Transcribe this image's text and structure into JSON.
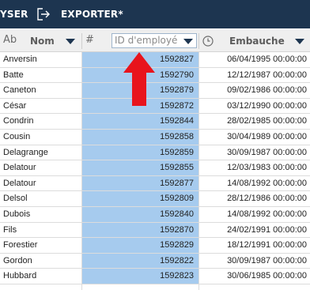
{
  "toolbar": {
    "analyser_label": "YSER",
    "exporter_label": "EXPORTER*",
    "export_icon": "export-icon"
  },
  "columns": {
    "name": {
      "type_glyph": "Ab",
      "label": "Nom"
    },
    "id": {
      "type_glyph": "#",
      "label": "ID d'employé"
    },
    "hire": {
      "type_icon": "clock-icon",
      "label": "Embauche"
    }
  },
  "colors": {
    "toolbar_bg": "#1d3550",
    "selected_column": "#a6cbee",
    "annotation_arrow": "#e8141c"
  },
  "rows": [
    {
      "name": "Anversin",
      "id": "1592827",
      "date": "06/04/1995 00:00:00"
    },
    {
      "name": "Batte",
      "id": "1592790",
      "date": "12/12/1987 00:00:00"
    },
    {
      "name": "Caneton",
      "id": "1592879",
      "date": "09/02/1986 00:00:00"
    },
    {
      "name": "César",
      "id": "1592872",
      "date": "03/12/1990 00:00:00"
    },
    {
      "name": "Condrin",
      "id": "1592844",
      "date": "28/02/1985 00:00:00"
    },
    {
      "name": "Cousin",
      "id": "1592858",
      "date": "30/04/1989 00:00:00"
    },
    {
      "name": "Delagrange",
      "id": "1592859",
      "date": "30/09/1987 00:00:00"
    },
    {
      "name": "Delatour",
      "id": "1592855",
      "date": "12/03/1983 00:00:00"
    },
    {
      "name": "Delatour",
      "id": "1592877",
      "date": "14/08/1992 00:00:00"
    },
    {
      "name": "Delsol",
      "id": "1592809",
      "date": "28/12/1986 00:00:00"
    },
    {
      "name": "Dubois",
      "id": "1592840",
      "date": "14/08/1992 00:00:00"
    },
    {
      "name": "Fils",
      "id": "1592870",
      "date": "24/02/1991 00:00:00"
    },
    {
      "name": "Forestier",
      "id": "1592829",
      "date": "18/12/1991 00:00:00"
    },
    {
      "name": "Gordon",
      "id": "1592822",
      "date": "30/09/1987 00:00:00"
    },
    {
      "name": "Hubbard",
      "id": "1592823",
      "date": "30/06/1985 00:00:00"
    }
  ]
}
